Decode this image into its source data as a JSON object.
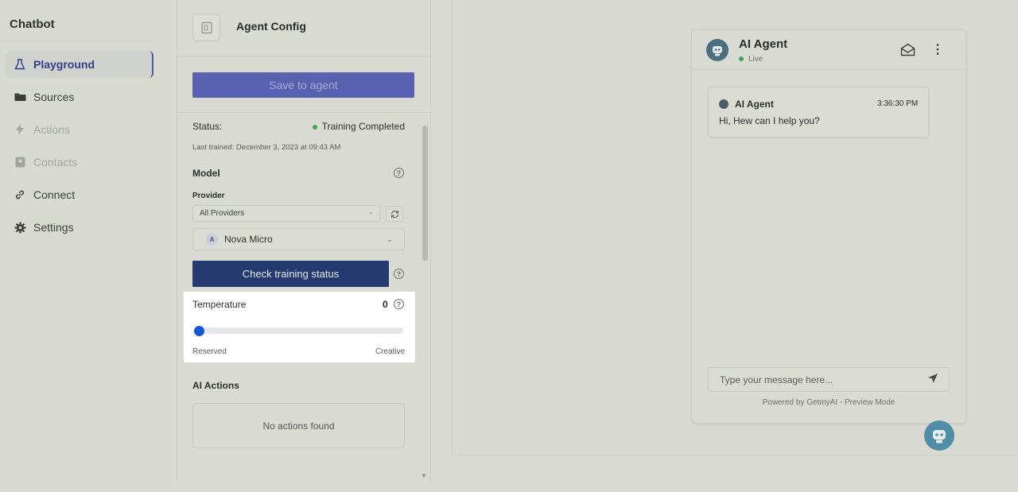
{
  "sidebar": {
    "title": "Chatbot",
    "items": [
      {
        "label": "Playground",
        "icon": "flask-icon"
      },
      {
        "label": "Sources",
        "icon": "folder-icon"
      },
      {
        "label": "Actions",
        "icon": "bolt-icon"
      },
      {
        "label": "Contacts",
        "icon": "contacts-icon"
      },
      {
        "label": "Connect",
        "icon": "link-icon"
      },
      {
        "label": "Settings",
        "icon": "gear-icon"
      }
    ]
  },
  "config": {
    "title": "Agent Config",
    "save_label": "Save to agent",
    "status_label": "Status:",
    "status_value": "Training Completed",
    "last_trained": "Last trained: December 3, 2023 at 09:43 AM",
    "model_label": "Model",
    "provider_label": "Provider",
    "provider_value": "All Providers",
    "model_badge": "A",
    "model_value": "Nova Micro",
    "check_label": "Check training status",
    "temperature": {
      "label": "Temperature",
      "value": "0",
      "level": 0,
      "min_label": "Reserved",
      "max_label": "Creative"
    },
    "ai_actions_label": "AI Actions",
    "no_actions": "No actions found"
  },
  "chat": {
    "agent_name": "AI Agent",
    "status": "Live",
    "messages": [
      {
        "sender": "AI Agent",
        "time": "3:36:30 PM",
        "text": "Hi, Hew can I help you?"
      }
    ],
    "input_placeholder": "Type your message here...",
    "powered_by": "Powered by GetmyAI - Preview Mode"
  },
  "colors": {
    "accent": "#5861b0",
    "primary_button": "#253a6e",
    "slider_thumb": "#1558d6",
    "live": "#3fa35a"
  }
}
